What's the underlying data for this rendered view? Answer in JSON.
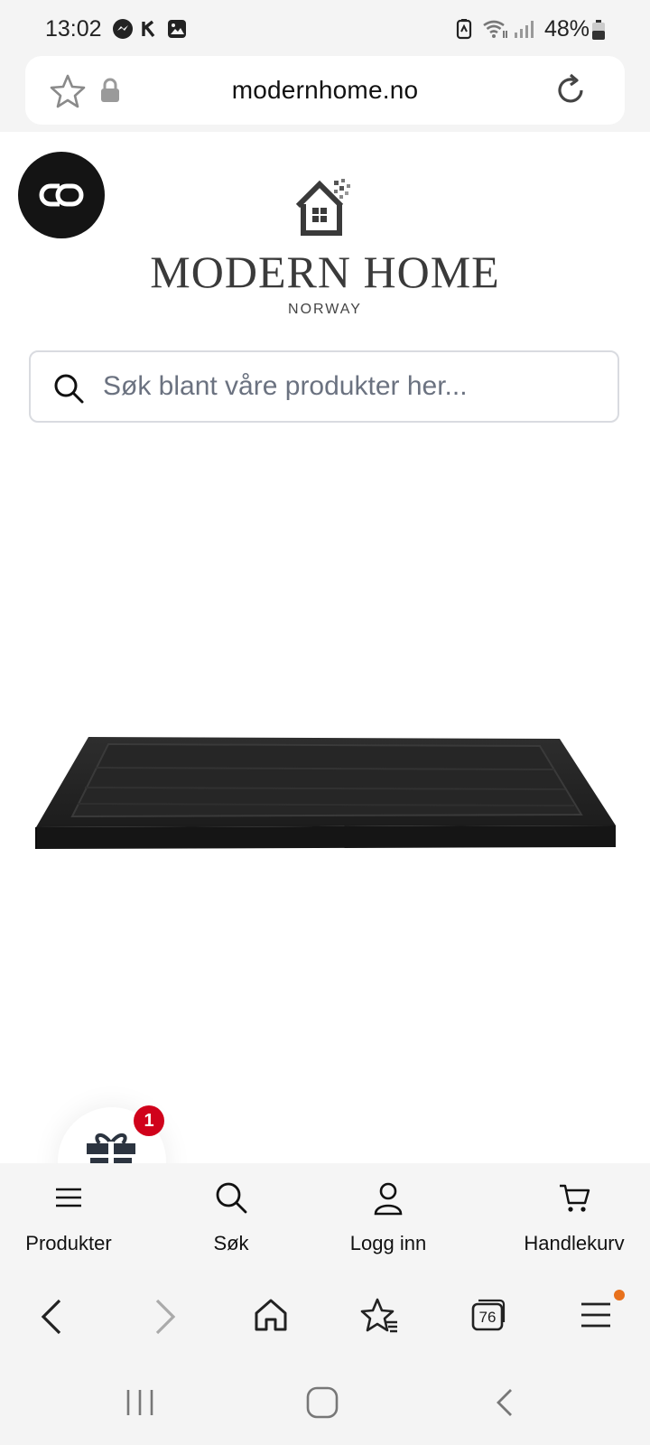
{
  "status_bar": {
    "time": "13:02",
    "battery": "48%",
    "icons": [
      "messenger-icon",
      "k-app-icon",
      "gallery-icon",
      "battery-saver-icon",
      "wifi-icon",
      "signal-icon",
      "battery-icon"
    ]
  },
  "browser": {
    "url": "modernhome.no",
    "tab_count": "76"
  },
  "logo": {
    "title": "MODERN HOME",
    "subtitle": "NORWAY"
  },
  "search": {
    "placeholder": "Søk blant våre produkter her..."
  },
  "gift": {
    "badge_count": "1"
  },
  "site_nav": {
    "items": [
      {
        "label": "Produkter",
        "icon": "menu-icon"
      },
      {
        "label": "Søk",
        "icon": "search-icon"
      },
      {
        "label": "Logg inn",
        "icon": "user-icon"
      },
      {
        "label": "Handlekurv",
        "icon": "cart-icon"
      }
    ]
  },
  "colors": {
    "accent_badge": "#d0021b",
    "notification_dot": "#e8711c",
    "bar_bg": "#f4f4f4"
  }
}
